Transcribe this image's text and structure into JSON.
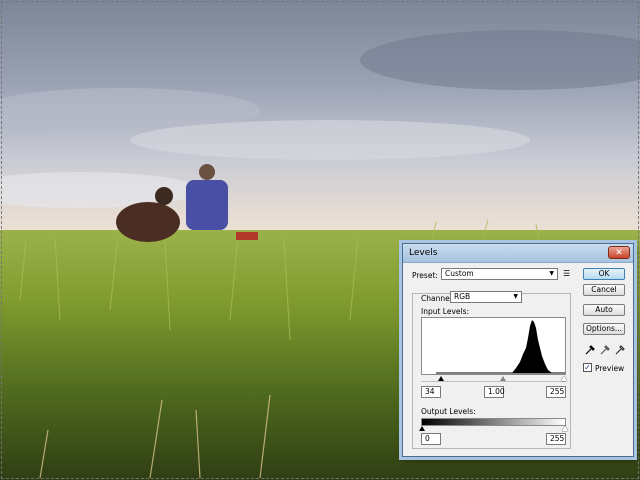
{
  "dialog": {
    "title": "Levels",
    "close_label": "✕",
    "preset": {
      "label": "Preset:",
      "value": "Custom"
    },
    "channel": {
      "label": "Channel:",
      "value": "RGB"
    },
    "input_levels": {
      "label": "Input Levels:",
      "black": "34",
      "gamma": "1.00",
      "white": "255"
    },
    "output_levels": {
      "label": "Output Levels:",
      "black": "0",
      "white": "255"
    },
    "buttons": {
      "ok": "OK",
      "cancel": "Cancel",
      "auto": "Auto",
      "options": "Options..."
    },
    "preview": {
      "label": "Preview",
      "checked": true
    }
  },
  "colors": {
    "accent": "#3c7fb1",
    "titlebar": "#a7c3e1",
    "close": "#c7442a"
  },
  "icons": [
    "preset-menu-icon",
    "black-eyedropper-icon",
    "gray-eyedropper-icon",
    "white-eyedropper-icon",
    "chevron-down-icon",
    "close-icon"
  ]
}
